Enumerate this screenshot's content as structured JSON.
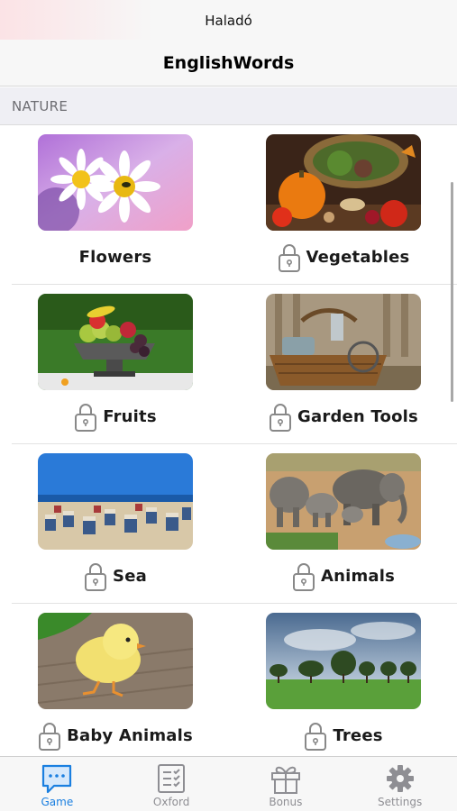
{
  "status_bar": {
    "carrier": "Haladó"
  },
  "nav": {
    "title": "EnglishWords"
  },
  "section": {
    "header": "NATURE"
  },
  "categories": [
    {
      "label": "Flowers",
      "locked": false,
      "image": "daisies-photo"
    },
    {
      "label": "Vegetables",
      "locked": true,
      "image": "vegetables-basket-photo"
    },
    {
      "label": "Fruits",
      "locked": true,
      "image": "fruit-bowl-photo"
    },
    {
      "label": "Garden Tools",
      "locked": true,
      "image": "garden-basket-photo"
    },
    {
      "label": "Sea",
      "locked": true,
      "image": "beach-chairs-photo"
    },
    {
      "label": "Animals",
      "locked": true,
      "image": "elephants-photo"
    },
    {
      "label": "Baby Animals",
      "locked": true,
      "image": "chick-photo"
    },
    {
      "label": "Trees",
      "locked": true,
      "image": "trees-field-photo"
    }
  ],
  "tabs": [
    {
      "label": "Game",
      "icon": "chat-icon",
      "active": true
    },
    {
      "label": "Oxford",
      "icon": "checklist-icon",
      "active": false
    },
    {
      "label": "Bonus",
      "icon": "gift-icon",
      "active": false
    },
    {
      "label": "Settings",
      "icon": "gear-icon",
      "active": false
    }
  ],
  "colors": {
    "accent": "#1a7fe0",
    "inactive": "#8e8e93",
    "header_bg": "#efeff4"
  }
}
